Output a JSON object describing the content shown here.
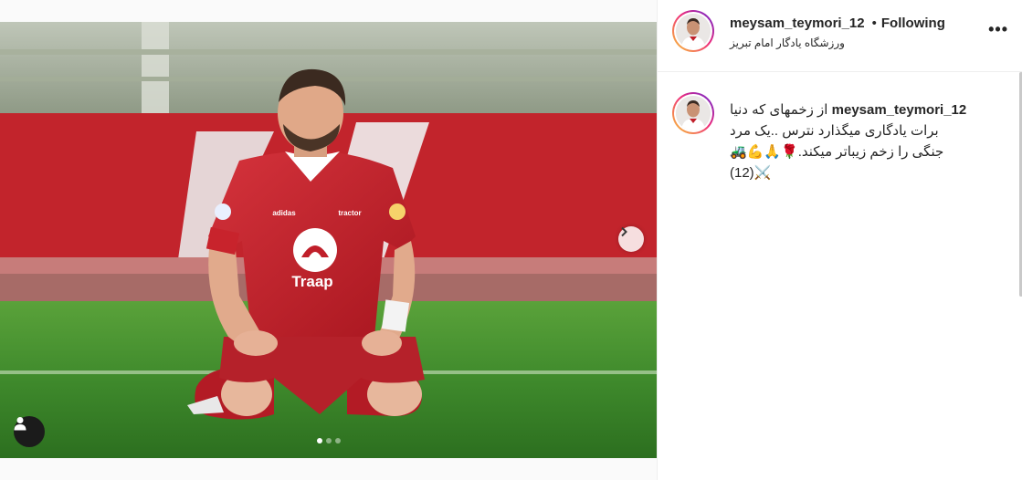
{
  "post": {
    "username": "meysam_teymori_12",
    "follow_status": "Following",
    "separator": "•",
    "location": "ورزشگاه یادگار امام تبریز",
    "more_icon": "more-horizontal-icon",
    "caption_lines": [
      "از زخمهای که دنیا",
      "برات یادگاری میگذارد نترس ..یک مرد",
      "جنگی را زخم زیباتر میکند.🌹🙏💪🚜",
      "(12)⚔️"
    ],
    "media": {
      "jersey_sponsor": "Traap",
      "jersey_brand": "tractor",
      "jersey_kit": "adidas",
      "carousel_dots": 3,
      "active_dot": 1,
      "next_icon": "chevron-right-icon",
      "tag_icon": "user-tag-icon"
    }
  },
  "colors": {
    "jersey": "#c01f2a",
    "pitch": "#3f8a2c",
    "avatar_ring_start": "#f9ce34",
    "avatar_ring_end": "#6228d7"
  }
}
